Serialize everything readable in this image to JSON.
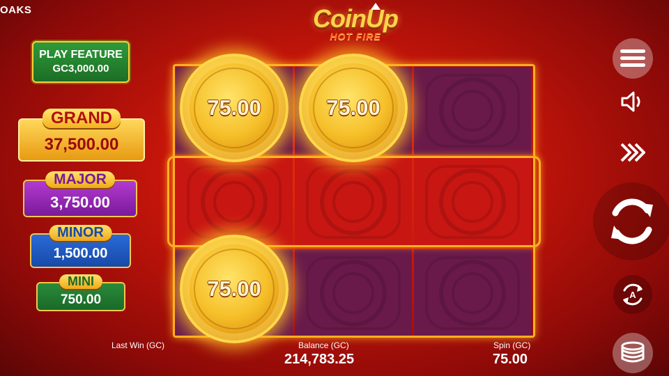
{
  "brand": "OAKS",
  "logo": {
    "title": "CoinUp",
    "subtitle": "HOT FIRE"
  },
  "play_feature": {
    "line1": "PLAY FEATURE",
    "line2": "GC3,000.00"
  },
  "jackpots": {
    "grand": {
      "name": "GRAND",
      "value": "37,500.00"
    },
    "major": {
      "name": "MAJOR",
      "value": "3,750.00"
    },
    "minor": {
      "name": "MINOR",
      "value": "1,500.00"
    },
    "mini": {
      "name": "MINI",
      "value": "750.00"
    }
  },
  "reels": {
    "rows": [
      [
        {
          "type": "coin",
          "value": "75.00"
        },
        {
          "type": "coin",
          "value": "75.00"
        },
        {
          "type": "empty",
          "color": "purple"
        }
      ],
      [
        {
          "type": "empty",
          "color": "red"
        },
        {
          "type": "empty",
          "color": "red"
        },
        {
          "type": "empty",
          "color": "red"
        }
      ],
      [
        {
          "type": "coin",
          "value": "75.00"
        },
        {
          "type": "empty",
          "color": "purple"
        },
        {
          "type": "empty",
          "color": "purple"
        }
      ]
    ]
  },
  "footer": {
    "last_win_label": "Last Win (GC)",
    "balance_label": "Balance (GC)",
    "balance_value": "214,783.25",
    "spin_label": "Spin (GC)",
    "spin_value": "75.00"
  },
  "controls": {
    "menu": "hamburger-menu-icon",
    "sound": "speaker-icon",
    "turbo": "fast-forward-icon",
    "spin": "spin-arrows-icon",
    "autoplay": "autoplay-icon",
    "bet": "coin-stack-icon",
    "autoplay_letter": "A"
  },
  "colors": {
    "reel_red": "#c81612",
    "reel_purple": "#6a1a4a",
    "frame_gold": "#ffb020",
    "coin_gold": "#f6c02a"
  }
}
